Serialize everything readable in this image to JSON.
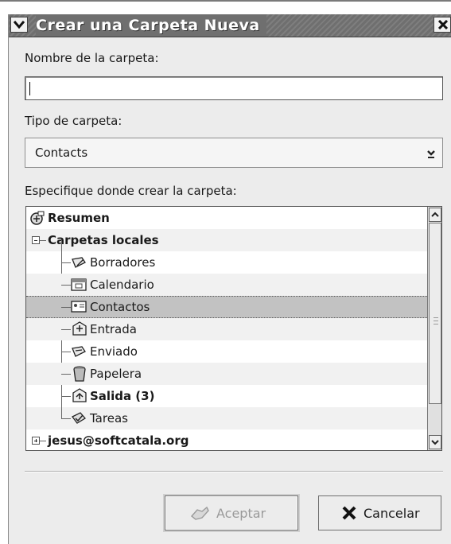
{
  "window": {
    "title": "Crear una Carpeta Nueva"
  },
  "form": {
    "name_label": "Nombre de la carpeta:",
    "name_value": "",
    "type_label": "Tipo de carpeta:",
    "type_selected": "Contacts",
    "location_label": "Especifique donde crear la carpeta:"
  },
  "tree": {
    "root": {
      "label": "Resumen",
      "icon": "summary-icon"
    },
    "local": {
      "label": "Carpetas locales",
      "expanded": true
    },
    "children": [
      {
        "label": "Borradores",
        "icon": "drafts-icon"
      },
      {
        "label": "Calendario",
        "icon": "calendar-icon"
      },
      {
        "label": "Contactos",
        "icon": "contacts-icon",
        "selected": true
      },
      {
        "label": "Entrada",
        "icon": "inbox-icon"
      },
      {
        "label": "Enviado",
        "icon": "sent-icon"
      },
      {
        "label": "Papelera",
        "icon": "trash-icon"
      },
      {
        "label": "Salida (3)",
        "icon": "outbox-icon",
        "bold": true
      },
      {
        "label": "Tareas",
        "icon": "tasks-icon"
      }
    ],
    "account": {
      "label": "jesus@softcatala.org",
      "expanded": false
    }
  },
  "buttons": {
    "accept": "Aceptar",
    "cancel": "Cancelar"
  },
  "colors": {
    "titlebar": "#6f6f6f",
    "selection": "#c2c2c2",
    "window_bg": "#ececec"
  }
}
